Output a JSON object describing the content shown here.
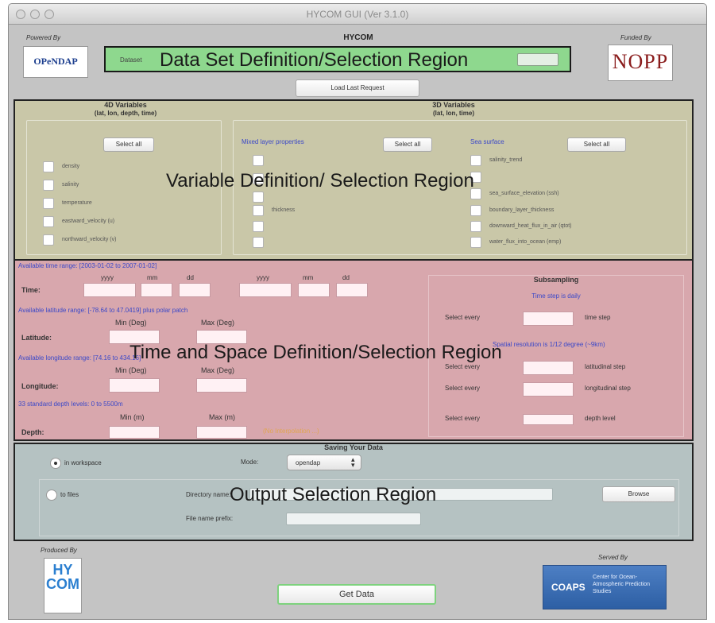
{
  "window": {
    "title": "HYCOM GUI (Ver 3.1.0)"
  },
  "header": {
    "powered_by": "Powered By",
    "opendap_logo": "OPeNDAP",
    "app_name": "HYCOM",
    "funded_by": "Funded By",
    "nopp_logo": "NOPP",
    "dataset_label": "Dataset",
    "load_last_request": "Load Last Request"
  },
  "regions": {
    "dataset": "Data Set Definition/Selection Region",
    "variables": "Variable Definition/ Selection Region",
    "time_space": "Time and Space Definition/Selection Region",
    "output": "Output Selection Region"
  },
  "variables": {
    "vars4d": {
      "title": "4D Variables",
      "subtitle": "(lat, lon, depth, time)",
      "select_all": "Select all",
      "items": [
        "density",
        "salinity",
        "temperature",
        "eastward_velocity (u)",
        "northward_velocity (v)"
      ]
    },
    "vars3d": {
      "title": "3D Variables",
      "subtitle": "(lat, lon, time)",
      "mixed_layer_title": "Mixed layer properties",
      "mixed_select_all": "Select all",
      "mixed_items": [
        "",
        "",
        "",
        "thickness",
        "",
        ""
      ],
      "sea_surface_title": "Sea surface",
      "sea_select_all": "Select all",
      "sea_items": [
        "salinity_trend",
        "",
        "sea_surface_elevation (ssh)",
        "boundary_layer_thickness",
        "downward_heat_flux_in_air (qtot)",
        "water_flux_into_ocean (emp)"
      ]
    }
  },
  "time_space": {
    "time_range": "Available time range: [2003-01-02 to 2007-01-02]",
    "col_yyyy": "yyyy",
    "col_mm": "mm",
    "col_dd": "dd",
    "time_label": "Time:",
    "lat_range": "Available latitude range: [-78.64 to 47.0419] plus polar patch",
    "min_deg": "Min (Deg)",
    "max_deg": "Max (Deg)",
    "latitude_label": "Latitude:",
    "lon_range": "Available longitude range: [74.16 to 434.16]",
    "longitude_label": "Longitude:",
    "depth_levels": "33 standard depth levels: 0 to 5500m",
    "min_m": "Min (m)",
    "max_m": "Max (m)",
    "depth_label": "Depth:",
    "depth_note": "(No Interpolation ...)",
    "subsampling": {
      "title": "Subsampling",
      "time_step_note": "Time step is daily",
      "select_every": "Select every",
      "time_step": "time step",
      "spatial_note": "Spatial resolution is 1/12 degree (~9km)",
      "latitudinal_step": "latitudinal step",
      "longitudinal_step": "longitudinal step",
      "depth_level": "depth level"
    }
  },
  "output": {
    "title": "Saving Your Data",
    "in_workspace": "in workspace",
    "mode_label": "Mode:",
    "mode_value": "opendap",
    "to_files": "to files",
    "directory_name": "Directory name:",
    "browse": "Browse",
    "file_name_prefix": "File name prefix:"
  },
  "footer": {
    "produced_by": "Produced By",
    "hycom_logo": "HY COM",
    "get_data": "Get Data",
    "served_by": "Served By",
    "coaps_logo": "COAPS",
    "coaps_text": "Center for Ocean-Atmospheric Prediction Studies"
  },
  "colors": {
    "window_bg": "#c4c4c4",
    "dataset_highlight": "#8ed88e",
    "variables_region": "#c9c7a8",
    "time_space_region": "#d8a7ad",
    "output_region": "#b5c2c2",
    "blue_text": "#3b48c8"
  }
}
